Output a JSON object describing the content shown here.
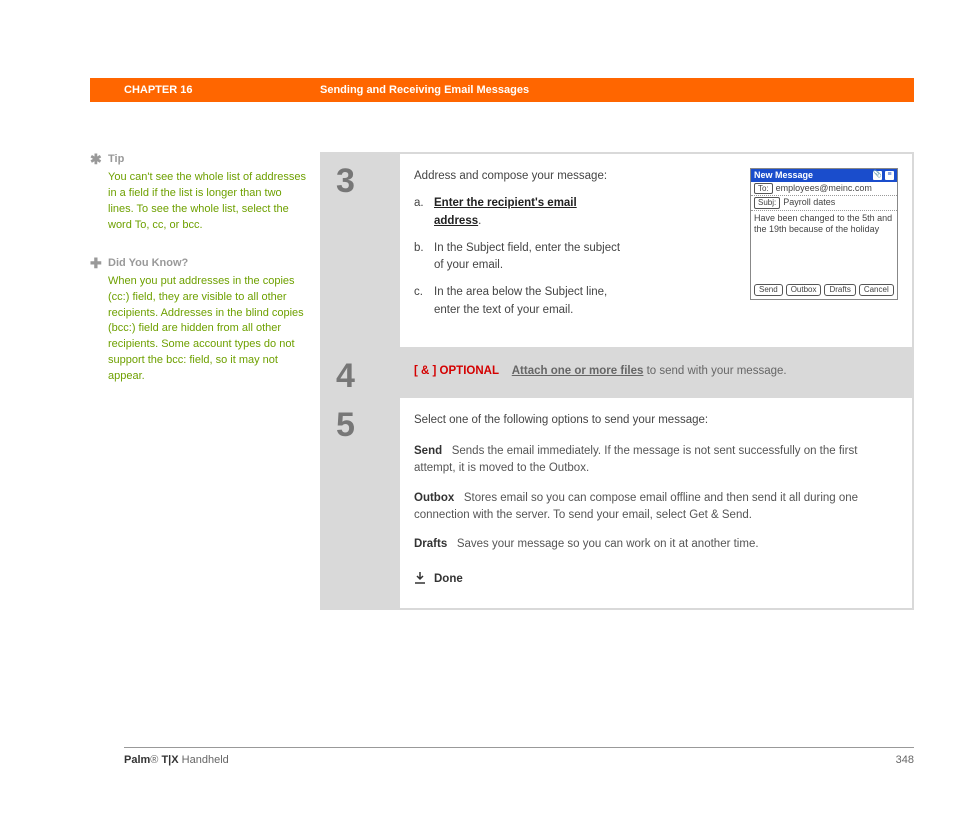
{
  "header": {
    "chapter": "CHAPTER 16",
    "title": "Sending and Receiving Email Messages"
  },
  "sidebar": {
    "tip": {
      "heading": "Tip",
      "body": "You can't see the whole list of addresses in a field if the list is longer than two lines. To see the whole list, select the word To, cc, or bcc."
    },
    "dyk": {
      "heading": "Did You Know?",
      "body": "When you put addresses in the copies (cc:) field, they are visible to all other recipients. Addresses in the blind copies (bcc:) field are hidden from all other recipients. Some account types do not support the bcc: field, so it may not appear."
    }
  },
  "steps": {
    "s3": {
      "num": "3",
      "intro": "Address and compose your message:",
      "a_letter": "a.",
      "a_text": "Enter the recipient's email address",
      "a_after": ".",
      "b_letter": "b.",
      "b_text": "In the Subject field, enter the subject of your email.",
      "c_letter": "c.",
      "c_text": "In the area below the Subject line, enter the text of your email."
    },
    "s4": {
      "num": "4",
      "tag": "[ & ]  OPTIONAL",
      "link": "Attach one or more files",
      "after": " to send with your message."
    },
    "s5": {
      "num": "5",
      "intro": "Select one of the following options to send your message:",
      "send_label": "Send",
      "send_text": "Sends the email immediately. If the message is not sent successfully on the first attempt, it is moved to the Outbox.",
      "outbox_label": "Outbox",
      "outbox_text": "Stores email so you can compose email offline and then send it all during one connection with the server. To send your email, select Get & Send.",
      "drafts_label": "Drafts",
      "drafts_text": "Saves your message so you can work on it at another time.",
      "done": "Done"
    }
  },
  "palm_screenshot": {
    "title": "New Message",
    "to_label": "To:",
    "to_value": "employees@meinc.com",
    "subj_label": "Subj:",
    "subj_value": "Payroll dates",
    "body": "Have been changed to the 5th and the 19th because of the holiday",
    "btn_send": "Send",
    "btn_outbox": "Outbox",
    "btn_drafts": "Drafts",
    "btn_cancel": "Cancel"
  },
  "footer": {
    "product_bold": "Palm",
    "product_reg": "®",
    "product_model": " T|X",
    "product_rest": " Handheld",
    "page": "348"
  }
}
